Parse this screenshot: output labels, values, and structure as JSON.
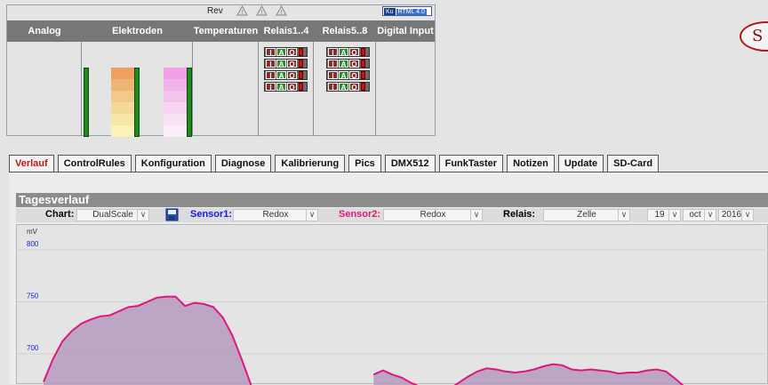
{
  "panel": {
    "rev": "Rev",
    "version_logo": "Ku",
    "version": "RTML 4.0",
    "columns": [
      "Analog",
      "Elektroden",
      "Temperaturen",
      "Relais1..4",
      "Relais5..8",
      "Digital Input"
    ]
  },
  "relay_buttons": [
    "I",
    "A",
    "O"
  ],
  "brand": "S",
  "tabs": [
    "Verlauf",
    "ControlRules",
    "Konfiguration",
    "Diagnose",
    "Kalibrierung",
    "Pics",
    "DMX512",
    "FunkTaster",
    "Notizen",
    "Update",
    "SD-Card"
  ],
  "active_tab": "Verlauf",
  "tagesverlauf": {
    "title": "Tagesverlauf",
    "chart_label": "Chart:",
    "chart_value": "DualScale",
    "sensor1_label": "Sensor1:",
    "sensor1_value": "Redox",
    "sensor2_label": "Sensor2:",
    "sensor2_value": "Redox",
    "relais_label": "Relais:",
    "relais_value": "Zelle",
    "day": "19",
    "month": "oct",
    "year": "2016"
  },
  "colors": {
    "sensor1": "#1a1ad8",
    "sensor2": "#e0167a",
    "area_fill": "#b69ac0",
    "electrode_stack_1": [
      "#eea060",
      "#f0b474",
      "#f4c888",
      "#f6d898",
      "#f8e6a6",
      "#faf2b6"
    ],
    "electrode_stack_2": [
      "#f0a0e6",
      "#f2b2ea",
      "#f4c4ee",
      "#f6d4f2",
      "#f8e2f6",
      "#faeef9"
    ]
  },
  "chart_data": {
    "type": "area",
    "ylabel": "mV",
    "yticks": [
      700,
      750,
      800
    ],
    "ylim": [
      670,
      808
    ],
    "x": [
      0,
      1,
      2,
      3,
      4,
      5,
      6,
      7,
      8,
      9,
      10,
      11,
      12,
      13,
      14,
      15,
      16,
      17,
      18,
      19,
      20,
      21,
      22,
      23,
      24,
      25,
      26,
      27,
      28,
      29,
      30,
      31,
      32,
      33,
      34,
      35,
      36,
      37,
      38,
      39,
      40,
      41,
      42,
      43,
      44,
      45,
      46,
      47,
      48,
      49,
      50,
      51,
      52,
      53,
      54,
      55,
      56,
      57,
      58,
      59,
      60,
      61,
      62,
      63,
      64,
      65,
      66,
      67,
      68,
      69
    ],
    "series": [
      {
        "values": [
          673,
          695,
          712,
          722,
          729,
          733,
          736,
          737,
          741,
          745,
          746,
          750,
          754,
          755,
          755,
          746,
          749,
          748,
          745,
          735,
          718,
          695,
          670,
          null,
          null,
          null,
          null,
          null,
          null,
          null,
          null,
          null,
          null,
          null,
          null,
          680,
          684,
          680,
          677,
          672,
          668,
          663,
          660,
          666,
          672,
          678,
          683,
          686,
          685,
          683,
          682,
          683,
          685,
          688,
          690,
          689,
          685,
          684,
          685,
          684,
          683,
          681,
          682,
          682,
          684,
          685,
          683,
          676,
          668,
          665
        ]
      }
    ]
  }
}
